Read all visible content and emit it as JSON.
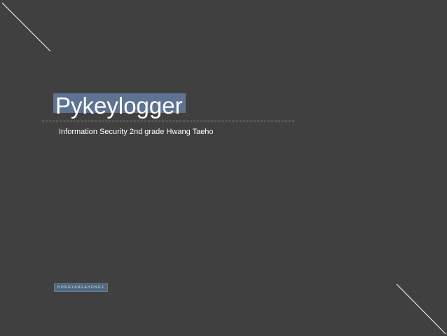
{
  "slide": {
    "title": "Pykeylogger",
    "subtitle": "Information Security 2nd grade Hwang Taeho",
    "logo_text": "HONGYANGAHONG3"
  },
  "colors": {
    "background": "#404040",
    "title_highlight": "#5e7391",
    "text": "#ffffff",
    "decor_line": "#ffffff"
  }
}
